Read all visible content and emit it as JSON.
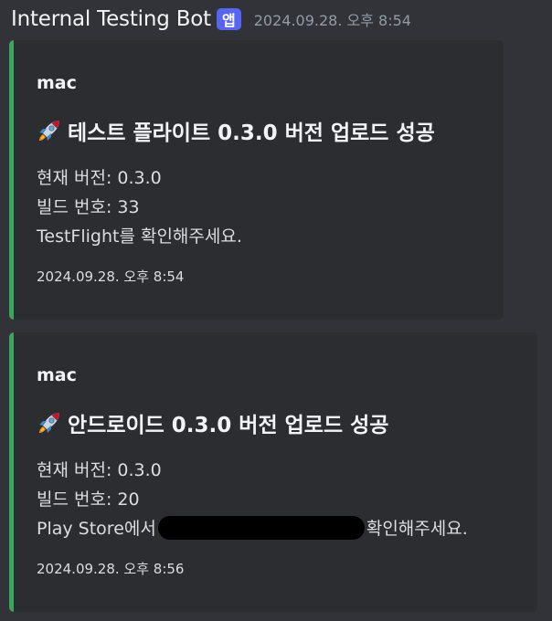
{
  "header": {
    "bot_name": "Internal Testing Bot",
    "badge": "앱",
    "timestamp": "2024.09.28. 오후 8:54"
  },
  "accent_color": "#3ba55c",
  "embeds": [
    {
      "author": "mac",
      "icon": "rocket-icon",
      "title": "테스트 플라이트 0.3.0 버전 업로드 성공",
      "lines": [
        "현재 버전: 0.3.0",
        "빌드 번호: 33",
        "TestFlight를 확인해주세요."
      ],
      "footer": "2024.09.28. 오후 8:54"
    },
    {
      "author": "mac",
      "icon": "rocket-icon",
      "title": "안드로이드 0.3.0 버전 업로드 성공",
      "lines": [
        "현재 버전: 0.3.0",
        "빌드 번호: 20"
      ],
      "line3_before": "Play Store에서",
      "line3_after": "확인해주세요.",
      "footer": "2024.09.28. 오후 8:56"
    }
  ]
}
